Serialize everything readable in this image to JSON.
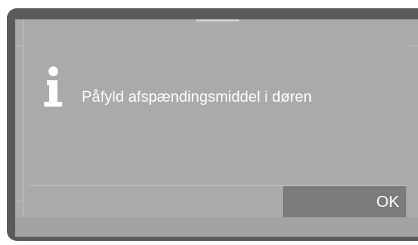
{
  "dialog": {
    "icon": "info-icon",
    "message": "Påfyld afspændingsmiddel i døren",
    "ok_label": "OK"
  },
  "colors": {
    "bezel": "#5a5a5a",
    "screen": "#aaaaaa",
    "button": "#7b7b7b",
    "text": "#ffffff"
  }
}
